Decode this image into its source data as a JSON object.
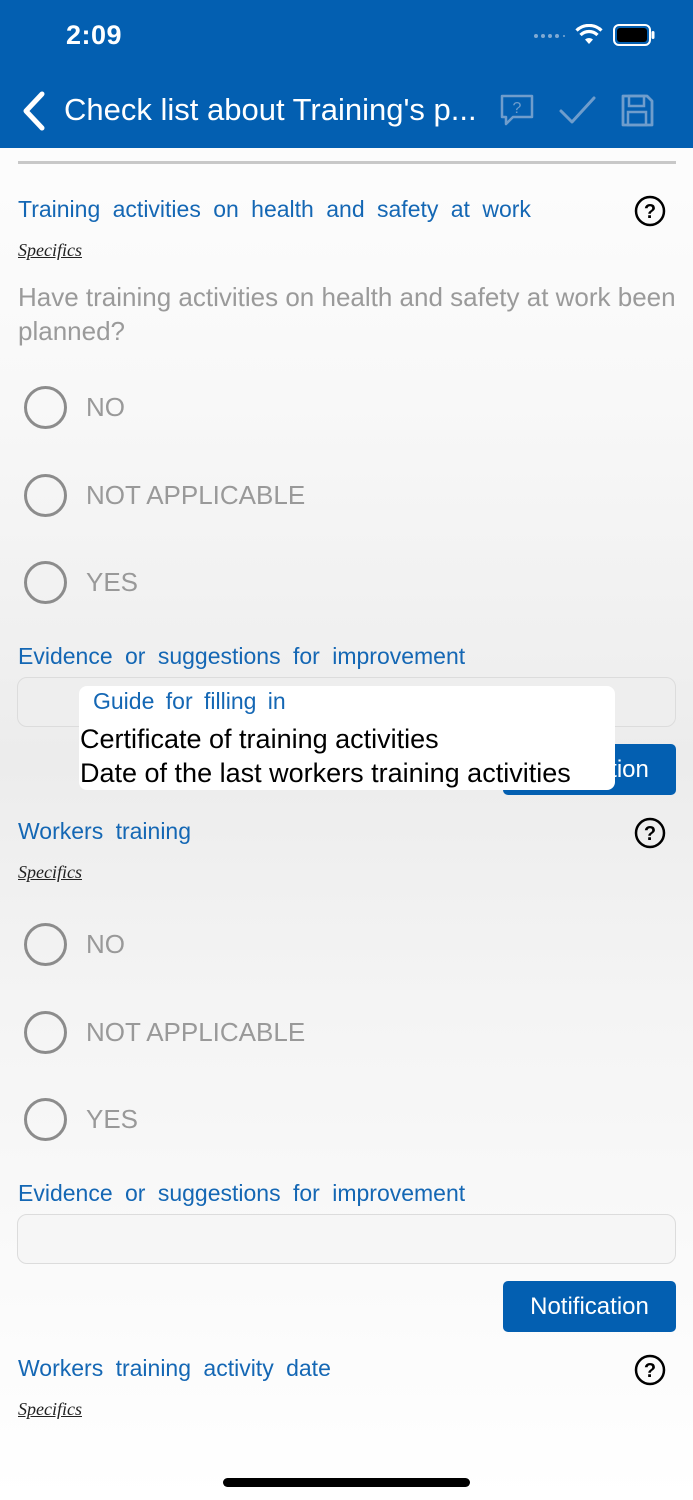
{
  "status_bar": {
    "time": "2:09"
  },
  "nav": {
    "title": "Check list about Training's p...",
    "icons": [
      "back-chevron-icon",
      "comment-question-icon",
      "checkmark-icon",
      "save-icon"
    ]
  },
  "colors": {
    "brand": "#035fb1",
    "link": "#1467b4",
    "muted": "#999999"
  },
  "section1": {
    "title": "Training activities on health and safety at work",
    "specifics": "Specifics",
    "question": "Have training activities on health and safety at work been planned?",
    "options": [
      "NO",
      "NOT APPLICABLE",
      "YES"
    ],
    "evidence_label": "Evidence or suggestions for improvement",
    "evidence_value": "",
    "notification": "Notification"
  },
  "tooltip": {
    "title": "Guide for filling in",
    "lines": [
      "Certificate of training activities",
      "Date of the last workers training activities"
    ]
  },
  "section2": {
    "title": "Workers training",
    "specifics": "Specifics",
    "options": [
      "NO",
      "NOT APPLICABLE",
      "YES"
    ],
    "evidence_label": "Evidence or suggestions for improvement",
    "evidence_value": "",
    "notification": "Notification"
  },
  "section3": {
    "title": "Workers training activity date",
    "specifics": "Specifics"
  }
}
